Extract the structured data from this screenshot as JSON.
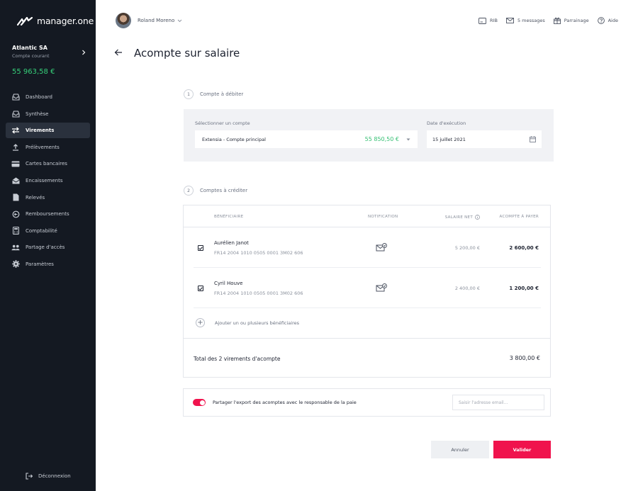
{
  "app": {
    "logo_text": "manager.one",
    "brand_color": "#f0134d",
    "positive_color": "#36c074"
  },
  "company": {
    "name": "Atlantic SA",
    "account_type": "Compte courant",
    "balance": "55 963,58 €"
  },
  "sidebar": {
    "items": [
      {
        "label": "Dashboard",
        "icon": "inbox-icon"
      },
      {
        "label": "Synthèse",
        "icon": "inbox-icon"
      },
      {
        "label": "Virements",
        "icon": "transfer-arrows-icon",
        "active": true
      },
      {
        "label": "Prélèvements",
        "icon": "upload-icon"
      },
      {
        "label": "Cartes bancaires",
        "icon": "credit-card-icon"
      },
      {
        "label": "Encaissements",
        "icon": "envelope-open-icon"
      },
      {
        "label": "Relevés",
        "icon": "document-icon"
      },
      {
        "label": "Remboursements",
        "icon": "refund-icon"
      },
      {
        "label": "Comptabilité",
        "icon": "calculator-icon"
      },
      {
        "label": "Partage d'accès",
        "icon": "users-icon"
      },
      {
        "label": "Paramètres",
        "icon": "gear-icon"
      }
    ],
    "logout_label": "Déconnexion"
  },
  "topbar": {
    "user_name": "Roland Moreno",
    "links": {
      "rib": "RIB",
      "messages": "5 messages",
      "referral": "Parrainage",
      "help": "Aide"
    }
  },
  "page": {
    "title": "Acompte sur salaire"
  },
  "step1": {
    "number": "1",
    "label": "Compte à débiter",
    "account_label": "Sélectionner un compte",
    "account_value": "Extensia - Compte principal",
    "account_balance": "55 850,50 €",
    "date_label": "Date d'exécution",
    "date_value": "15 juillet 2021"
  },
  "step2": {
    "number": "2",
    "label": "Comptes à créditer",
    "headers": {
      "beneficiary": "BÉNÉFICIAIRE",
      "notification": "NOTIFICATION",
      "net_salary": "SALAIRE NET",
      "advance": "ACOMPTE À PAYER"
    },
    "rows": [
      {
        "name": "Aurélien Janot",
        "iban": "FR14 2004 1010 0505 0001 3M02 606",
        "net_salary": "5 200,00 €",
        "advance": "2 600,00 €",
        "checked": true
      },
      {
        "name": "Cyril Houve",
        "iban": "FR14 2004 1010 0505 0001 3M02 606",
        "net_salary": "2 400,00 €",
        "advance": "1 200,00 €",
        "checked": true
      }
    ],
    "add_label": "Ajouter un ou plusieurs bénéficiaires",
    "total_label": "Total des 2 virements d'acompte",
    "total_value": "3 800,00 €"
  },
  "share": {
    "enabled": true,
    "label": "Partager l'export des acomptes avec le responsable de la paie",
    "email_placeholder": "Saisir l'adresse email..."
  },
  "actions": {
    "cancel": "Annuler",
    "submit": "Valider"
  }
}
